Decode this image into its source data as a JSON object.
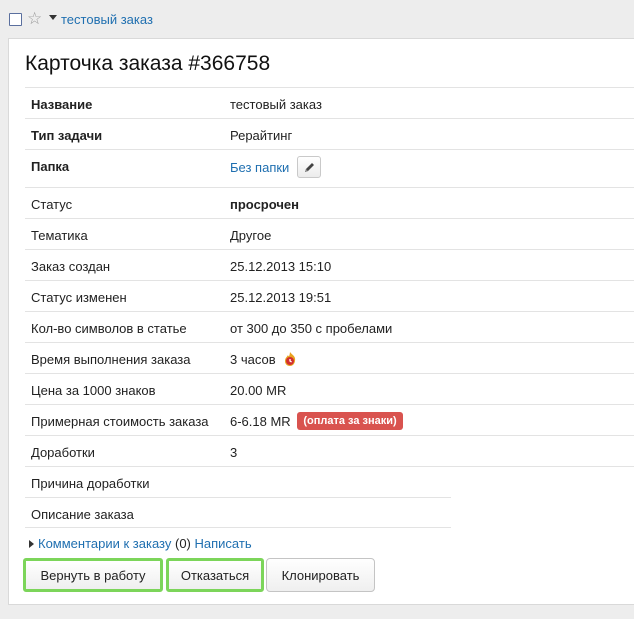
{
  "topbar": {
    "link": "тестовый заказ"
  },
  "card": {
    "title": "Карточка заказа #366758",
    "fields": {
      "name": {
        "label": "Название",
        "value": "тестовый заказ"
      },
      "task_type": {
        "label": "Тип задачи",
        "value": "Рерайтинг"
      },
      "folder": {
        "label": "Папка",
        "value": "Без папки"
      },
      "status": {
        "label": "Статус",
        "value": "просрочен"
      },
      "topic": {
        "label": "Тематика",
        "value": "Другое"
      },
      "created": {
        "label": "Заказ создан",
        "value": "25.12.2013 15:10"
      },
      "status_changed": {
        "label": "Статус изменен",
        "value": "25.12.2013 19:51"
      },
      "chars": {
        "label": "Кол-во символов в статье",
        "value": "от 300 до 350 с пробелами"
      },
      "time": {
        "label": "Время выполнения заказа",
        "value": "3 часов"
      },
      "price": {
        "label": "Цена за 1000 знаков",
        "value": "20.00 MR"
      },
      "cost": {
        "label": "Примерная стоимость заказа",
        "value": "6-6.18 MR",
        "badge": "(оплата за знаки)"
      },
      "revisions": {
        "label": "Доработки",
        "value": "3"
      },
      "revision_reason": {
        "label": "Причина доработки",
        "value": ""
      },
      "description": {
        "label": "Описание заказа",
        "value": ""
      }
    },
    "comments": {
      "link": "Комментарии к заказу",
      "count": "(0)",
      "write": "Написать"
    },
    "buttons": {
      "return": "Вернуть в работу",
      "refuse": "Отказаться",
      "clone": "Клонировать"
    }
  },
  "colors": {
    "link": "#1f6fb0",
    "badge": "#d9534f",
    "highlight": "#7cd55a"
  },
  "icons": [
    "checkbox-icon",
    "star-icon",
    "caret-down-icon",
    "pencil-icon",
    "fire-clock-icon",
    "triangle-right-icon"
  ]
}
